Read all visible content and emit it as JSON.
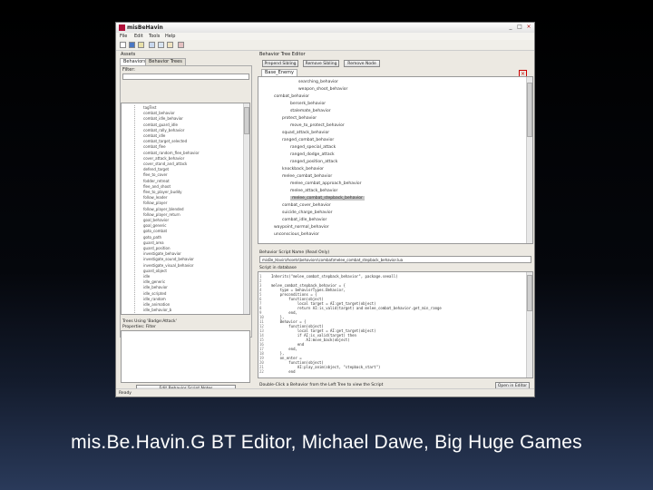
{
  "window": {
    "title": "misBeHavin",
    "controls": [
      "_",
      "□",
      "×"
    ]
  },
  "menu": [
    "File",
    "Edit",
    "Tools",
    "Help"
  ],
  "left_panel": {
    "header": "Assets",
    "tabs": [
      "Behaviors",
      "Behavior Trees"
    ],
    "filter_label": "Filter:",
    "items": [
      "tagTest",
      "combat_behavior",
      "combat_idle_behavior",
      "combat_guard_idle",
      "combat_rally_behavior",
      "combat_idle",
      "combat_target_selected",
      "combat_flee",
      "combat_random_flee_behavior",
      "cover_attack_behavior",
      "cover_stand_and_attack",
      "defend_target",
      "flee_to_cover",
      "fodder_retreat",
      "flee_and_shoot",
      "flee_to_player_buddy",
      "follow_leader",
      "follow_player",
      "follow_player_blended",
      "follow_player_return",
      "goal_behavior",
      "goal_generic",
      "goto_combat",
      "goto_path",
      "guard_area",
      "guard_position",
      "investigate_behavior",
      "investigate_sound_behavior",
      "investigate_visual_behavior",
      "guard_object",
      "idle",
      "idle_generic",
      "idle_behavior",
      "idle_scripted",
      "idle_random",
      "idle_animation",
      "idle_behavior_b"
    ],
    "info_lines": [
      "Trees Using 'Badge:Attack'",
      "Properties: Filter"
    ],
    "bottom_button": "Edit Behavior Script Notes"
  },
  "right_panel": {
    "header": "Behavior Tree Editor",
    "buttons": [
      "Prepend Sibling",
      "Remove Sibling",
      "Remove Node"
    ],
    "tab": "Base_Enemy",
    "nodes": [
      {
        "text": "searching_behavior",
        "depth": 4,
        "selected": false
      },
      {
        "text": "weapon_shoot_behavior",
        "depth": 4,
        "selected": false
      },
      {
        "text": "combat_behavior",
        "depth": 1,
        "selected": false
      },
      {
        "text": "berserk_behavior",
        "depth": 3,
        "selected": false
      },
      {
        "text": "stalemate_behavior",
        "depth": 3,
        "selected": false
      },
      {
        "text": "protect_behavior",
        "depth": 2,
        "selected": false
      },
      {
        "text": "move_to_protect_behavior",
        "depth": 3,
        "selected": false
      },
      {
        "text": "squad_attack_behavior",
        "depth": 2,
        "selected": false
      },
      {
        "text": "ranged_combat_behavior",
        "depth": 2,
        "selected": false
      },
      {
        "text": "ranged_special_attack",
        "depth": 3,
        "selected": false
      },
      {
        "text": "ranged_dodge_attack",
        "depth": 3,
        "selected": false
      },
      {
        "text": "ranged_position_attack",
        "depth": 3,
        "selected": false
      },
      {
        "text": "knockback_behavior",
        "depth": 2,
        "selected": false
      },
      {
        "text": "melee_combat_behavior",
        "depth": 2,
        "selected": false
      },
      {
        "text": "melee_combat_approach_behavior",
        "depth": 3,
        "selected": false
      },
      {
        "text": "melee_attack_behavior",
        "depth": 3,
        "selected": false
      },
      {
        "text": "melee_combat_stepback_behavior",
        "depth": 3,
        "selected": true
      },
      {
        "text": "combat_cover_behavior",
        "depth": 2,
        "selected": false
      },
      {
        "text": "suicide_charge_behavior",
        "depth": 2,
        "selected": false
      },
      {
        "text": "combat_idle_behavior",
        "depth": 2,
        "selected": false
      },
      {
        "text": "waypoint_normal_behavior",
        "depth": 1,
        "selected": false
      },
      {
        "text": "unconscious_behavior",
        "depth": 1,
        "selected": false
      }
    ],
    "path_label": "Behavior Script Name (Read Only)",
    "path_value": "misBe_Havin\\Assets\\behaviors\\combat\\melee_combat_stepback_behavior.lua",
    "script_label": "Script in database",
    "code": [
      "Inherits(\"melee_combat_stepback_behavior\", package.seeall)",
      "",
      "melee_combat_stepback_behavior = {",
      "    type = behaviorTypes.Behavior,",
      "    preconditions = {",
      "        function(object)",
      "            local target = AI:get_target(object)",
      "            return AI:is_valid(target) and melee_combat_behavior.get_min_range",
      "        end,",
      "    },",
      "    Behavior = {",
      "        function(object)",
      "            local target = AI:get_target(object)",
      "            if AI:is_valid(target) then",
      "                AI:move_back(object)",
      "            end",
      "        end,",
      "    },",
      "    on_enter =",
      "        function(object)",
      "            AI:play_anim(object, \"stepback_start\")",
      "        end"
    ],
    "status": "Double-Click a Behavior from the Left Tree to view the Script",
    "open_button": "Open in Editor"
  },
  "status_bar": "Ready",
  "caption": "mis.Be.Havin.G BT Editor, Michael Dawe, Big Huge Games"
}
